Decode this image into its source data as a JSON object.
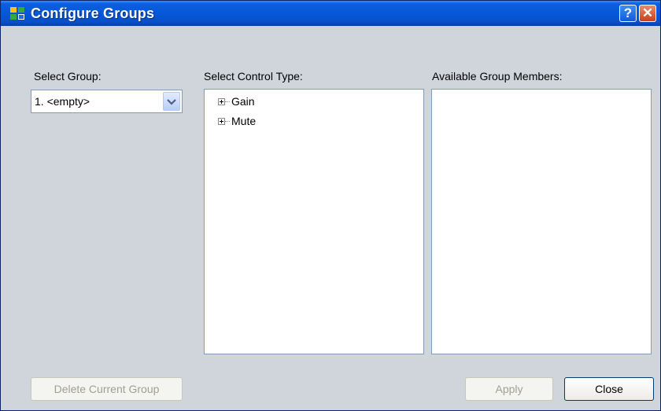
{
  "window": {
    "title": "Configure Groups",
    "help_label": "?",
    "close_glyph": "✕"
  },
  "select_group": {
    "label": "Select Group:",
    "selected": "1. <empty>"
  },
  "control_type": {
    "label": "Select Control Type:",
    "items": [
      {
        "label": "Gain",
        "expanded": false
      },
      {
        "label": "Mute",
        "expanded": false
      }
    ]
  },
  "members": {
    "label": "Available Group Members:"
  },
  "buttons": {
    "delete": "Delete Current Group",
    "apply": "Apply",
    "close": "Close"
  },
  "colors": {
    "titlebar": "#0557d6",
    "dialog_bg": "#d0d5db",
    "border": "#7f9db9"
  }
}
